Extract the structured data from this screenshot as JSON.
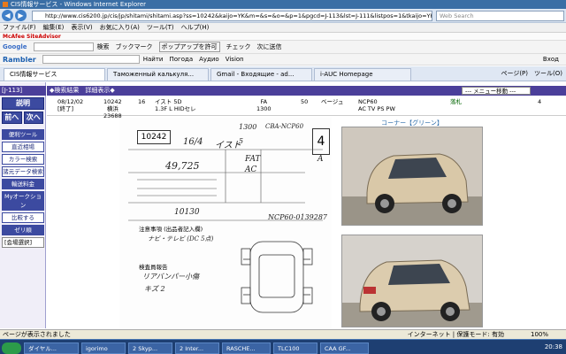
{
  "window": {
    "title": "CIS情報サービス - Windows Internet Explorer"
  },
  "address": {
    "url": "http://www.cis6200.jp/cis/jp/shitami/shitami.asp?ss=10242&kaijo=YK&m=&s=&o=&p=1&pgcd=J-113&lst=J-111&listpos=1&tkaijo=YK&t",
    "search_placeholder": "Web Search"
  },
  "menubar": [
    "ファイル(F)",
    "編集(E)",
    "表示(V)",
    "お気に入り(A)",
    "ツール(T)",
    "ヘルプ(H)"
  ],
  "mcafee": "McAfee SiteAdvisor",
  "toolbar1": {
    "google": "Google",
    "items": [
      "検索",
      "ブックマーク",
      "ポップアップを許可",
      "チェック",
      "次に送信"
    ]
  },
  "toolbar2": {
    "rambler": "Rambler",
    "items": [
      "Найти",
      "Погода",
      "Аудио",
      "Vision",
      "Вход"
    ]
  },
  "tabs": [
    {
      "label": "CIS情報サービス",
      "active": true
    },
    {
      "label": "Таможенный калькуля...",
      "active": false
    },
    {
      "label": "Gmail - Входящие - ad...",
      "active": false
    },
    {
      "label": "i-AUC Homepage",
      "active": false
    }
  ],
  "tab_tools": [
    "ページ(P)",
    "ツール(O)"
  ],
  "sidebar": {
    "top_num": "[J-113]",
    "buttons": [
      "説明",
      "前へ",
      "次へ",
      "便利ツール"
    ],
    "small_buttons": [
      "直近相場",
      "カラー検索",
      "諸元データ検索",
      "輸送料金",
      "Myオークション",
      "比較する",
      "ゼリ順"
    ],
    "select": "[会場選択]"
  },
  "header": {
    "title": "◆検索結果　詳細表示◆",
    "menu": "--- メニュー移動 ---"
  },
  "detail_row": {
    "date": "08/12/02",
    "status": "[終了]",
    "lot": "10242",
    "venue": "横浜",
    "lot2": "23688",
    "col1": "16",
    "maker": "イスト 5D",
    "grade": "1.3F L HIDセレ",
    "type": "FA",
    "cc": "1300",
    "col2": "50",
    "color": "ベージュ",
    "model": "NCP60",
    "equip": "AC TV PS PW",
    "result": "落札",
    "col3": "4"
  },
  "sheet": {
    "lot": "10242",
    "model": "イスト",
    "year": "16/4",
    "score": "4",
    "interior": "A",
    "mileage": "49,725",
    "trans": "FAT",
    "ac": "AC",
    "recycle": "10130",
    "chassis": "NCP60-0139287",
    "note_label": "注意事項 (出品者記入欄)",
    "note": "ナビ・テレビ (DC 5点)",
    "check_label": "検査員報告",
    "check": "リアバンパー小傷",
    "check2": "キズ 2",
    "cc": "1300",
    "model_code": "CBA-NCP60",
    "doors": "5"
  },
  "corner_label": "コーナー【グリーン】",
  "status": {
    "text": "ページが表示されました",
    "zone": "インターネット | 保護モード: 有効",
    "zoom": "100%"
  },
  "taskbar": {
    "items": [
      "ダイヤル...",
      "igorimo",
      "2 Skyp...",
      "2 Inter...",
      "RASCHE...",
      "TLC100",
      "CAA GF..."
    ],
    "clock": "20:38"
  }
}
